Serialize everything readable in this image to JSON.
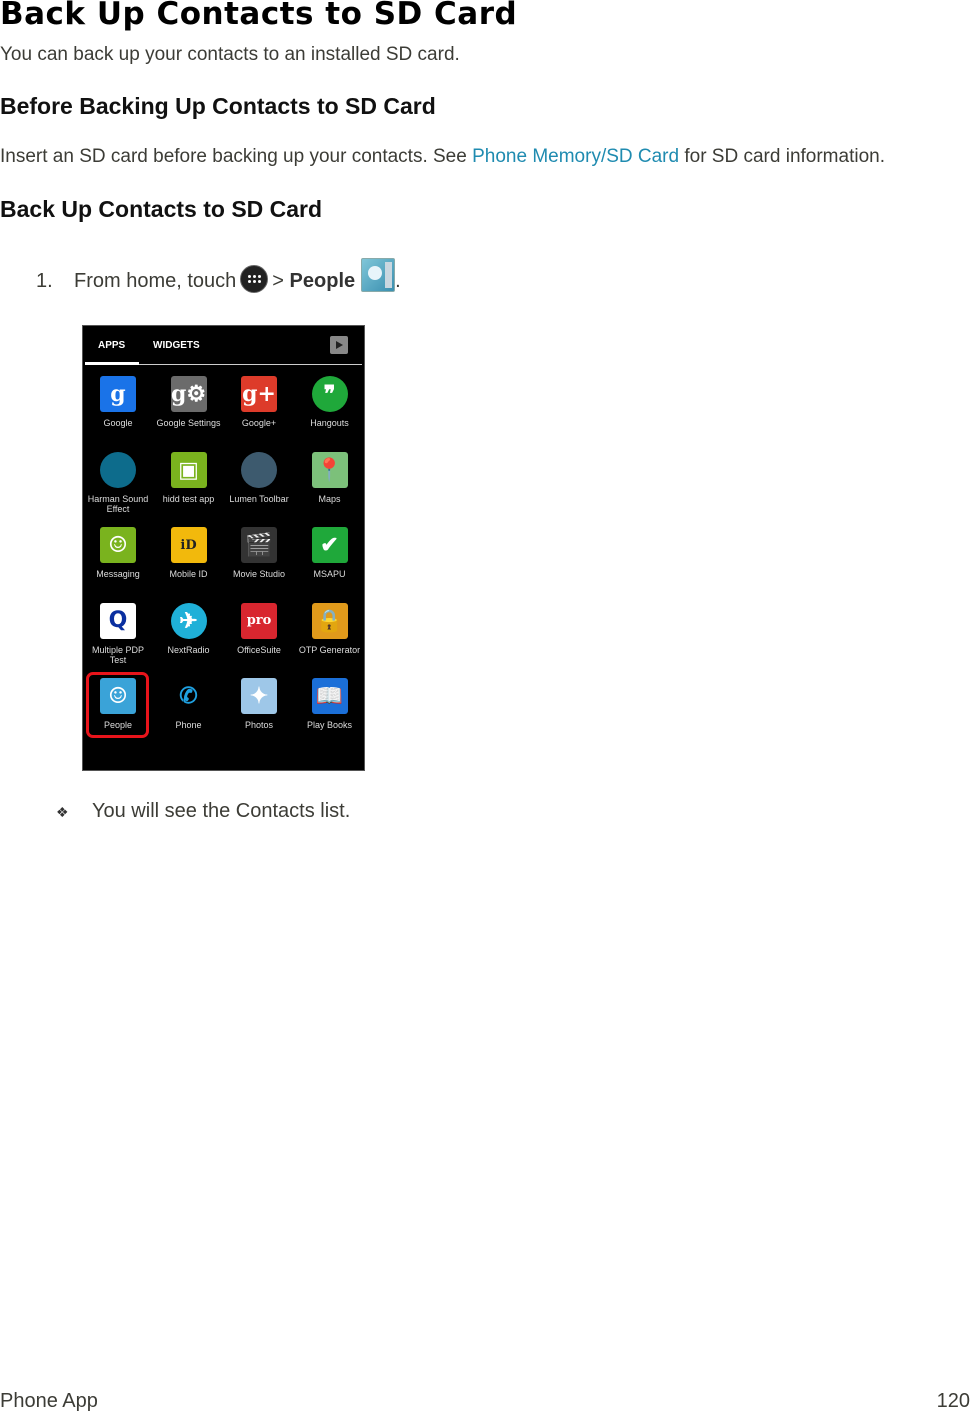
{
  "title": "Back Up Contacts to SD Card",
  "intro": "You can back up your contacts to an installed SD card.",
  "section1": {
    "heading": "Before Backing Up Contacts to SD Card",
    "text_before": "Insert an SD card before backing up your contacts. See ",
    "link": "Phone Memory/SD Card",
    "text_after": " for SD card information."
  },
  "section2": {
    "heading": "Back Up Contacts to SD Card",
    "step": {
      "number": "1.",
      "text_before": "From home, touch",
      "icon1": "apps-launcher-icon",
      "separator": ">",
      "bold": "People",
      "icon2": "people-app-icon",
      "end": "."
    },
    "screenshot": {
      "tabs": [
        "APPS",
        "WIDGETS"
      ],
      "active_tab": "APPS",
      "store_icon": "play-store-icon",
      "apps": [
        {
          "label": "Google",
          "icon": "google-icon",
          "glyph": "g",
          "color": "#1a73e8"
        },
        {
          "label": "Google Settings",
          "icon": "google-settings-icon",
          "glyph": "g⚙",
          "color": "#6b6b6b"
        },
        {
          "label": "Google+",
          "icon": "google-plus-icon",
          "glyph": "g+",
          "color": "#dd3b2a"
        },
        {
          "label": "Hangouts",
          "icon": "hangouts-icon",
          "glyph": "❞",
          "color": "#1fa83a"
        },
        {
          "label": "Harman Sound Effect",
          "icon": "harman-icon",
          "glyph": "",
          "color": "#0d6c8c"
        },
        {
          "label": "hidd test app",
          "icon": "hidd-test-icon",
          "glyph": "▣",
          "color": "#7ab31e"
        },
        {
          "label": "Lumen Toolbar",
          "icon": "lumen-toolbar-icon",
          "glyph": "",
          "color": "#3d5a6e"
        },
        {
          "label": "Maps",
          "icon": "maps-icon",
          "glyph": "📍",
          "color": "#7cc07a"
        },
        {
          "label": "Messaging",
          "icon": "messaging-icon",
          "glyph": "☺",
          "color": "#7ab31e"
        },
        {
          "label": "Mobile ID",
          "icon": "mobile-id-icon",
          "glyph": "iD",
          "color": "#f2b90c"
        },
        {
          "label": "Movie Studio",
          "icon": "movie-studio-icon",
          "glyph": "🎬",
          "color": "#333"
        },
        {
          "label": "MSAPU",
          "icon": "msapu-icon",
          "glyph": "✔",
          "color": "#1fa83a"
        },
        {
          "label": "Multiple PDP Test",
          "icon": "multiple-pdp-icon",
          "glyph": "Q",
          "color": "#ffffff"
        },
        {
          "label": "NextRadio",
          "icon": "nextradio-icon",
          "glyph": "✈",
          "color": "#1fb0d8"
        },
        {
          "label": "OfficeSuite",
          "icon": "officesuite-icon",
          "glyph": "pro",
          "color": "#d8262f"
        },
        {
          "label": "OTP Generator",
          "icon": "otp-generator-icon",
          "glyph": "🔒",
          "color": "#e09a1b"
        },
        {
          "label": "People",
          "icon": "people-icon",
          "glyph": "☺",
          "color": "#3aa3d8"
        },
        {
          "label": "Phone",
          "icon": "phone-icon",
          "glyph": "✆",
          "color": "#000"
        },
        {
          "label": "Photos",
          "icon": "photos-icon",
          "glyph": "✦",
          "color": "#9ec7e8"
        },
        {
          "label": "Play Books",
          "icon": "play-books-icon",
          "glyph": "📖",
          "color": "#1b6fd8"
        }
      ],
      "highlighted_app": "People"
    },
    "result": "You will see the Contacts list."
  },
  "footer": {
    "section": "Phone App",
    "page": "120"
  }
}
